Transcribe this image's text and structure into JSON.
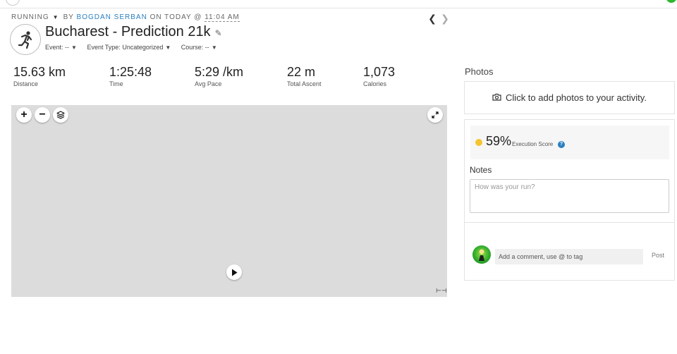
{
  "header": {
    "activity_type": "RUNNING",
    "by_label": "BY",
    "author": "BOGDAN SERBAN",
    "on_label": "ON TODAY @",
    "time": "11:04 AM"
  },
  "activity": {
    "title": "Bucharest - Prediction 21k",
    "event": "Event: --",
    "event_type": "Event Type: Uncategorized",
    "course": "Course: --"
  },
  "stats": [
    {
      "value": "15.63 km",
      "label": "Distance"
    },
    {
      "value": "1:25:48",
      "label": "Time"
    },
    {
      "value": "5:29 /km",
      "label": "Avg Pace"
    },
    {
      "value": "22 m",
      "label": "Total Ascent"
    },
    {
      "value": "1,073",
      "label": "Calories"
    }
  ],
  "map": {
    "zoom_in": "+",
    "zoom_out": "−"
  },
  "photos": {
    "heading": "Photos",
    "add_text": "Click to add photos to your activity."
  },
  "execution": {
    "score": "59%",
    "label": "Execution Score",
    "help": "?",
    "dot_color": "#f5c431"
  },
  "notes": {
    "heading": "Notes",
    "placeholder": "How was your run?"
  },
  "comment": {
    "placeholder": "Add a comment, use @ to tag",
    "post_label": "Post"
  },
  "icons": {
    "activity": "running-person-icon",
    "camera": "camera-icon",
    "layers": "layers-icon",
    "fullscreen": "expand-icon",
    "play": "play-icon",
    "edit": "pencil-icon"
  },
  "colors": {
    "accent": "#2a7fc1",
    "map_bg": "#dcdcdc"
  }
}
